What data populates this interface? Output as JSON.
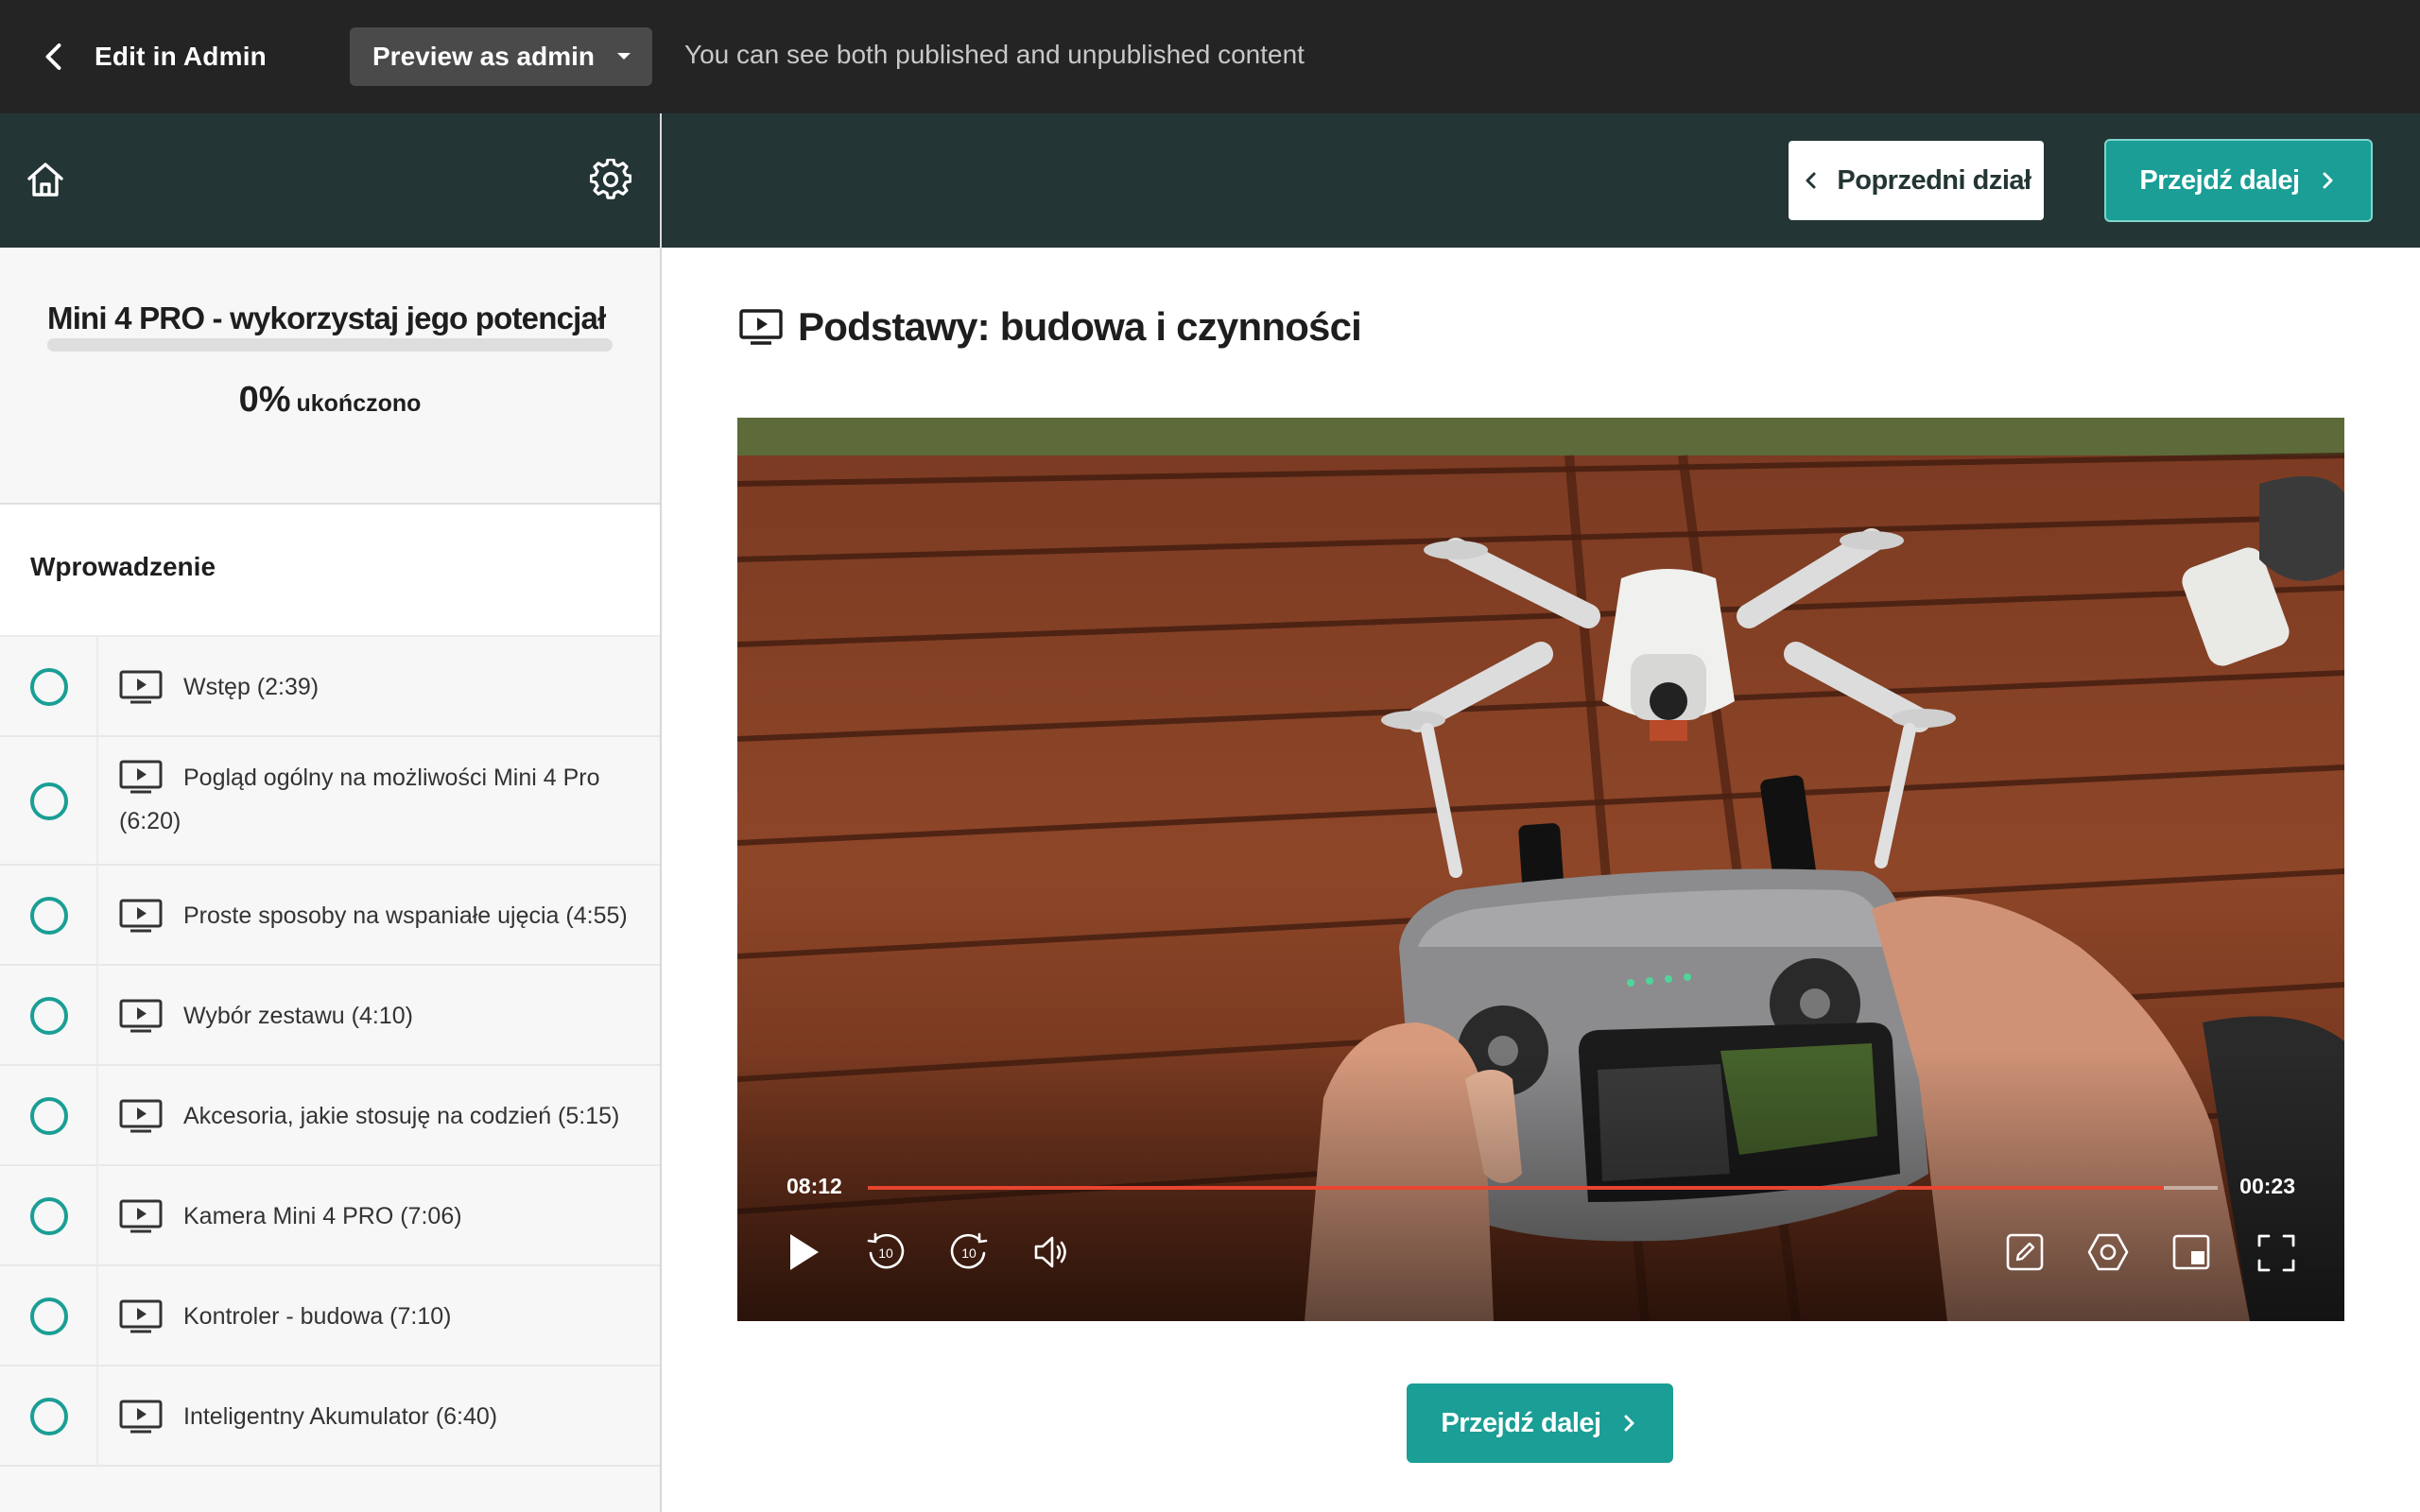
{
  "admin_bar": {
    "back_label": "Edit in Admin",
    "preview_label": "Preview as admin",
    "note": "You can see both published and unpublished content"
  },
  "sidebar": {
    "course_title": "Mini 4 PRO - wykorzystaj jego potencjał",
    "progress": {
      "percent_text": "0%",
      "percent": 0,
      "label": "ukończono"
    },
    "section_title": "Wprowadzenie",
    "lessons": [
      {
        "title": "Wstęp (2:39)"
      },
      {
        "title": "Pogląd ogólny na możliwości Mini 4 Pro (6:20)"
      },
      {
        "title": "Proste sposoby na wspaniałe ujęcia (4:55)"
      },
      {
        "title": "Wybór zestawu (4:10)"
      },
      {
        "title": "Akcesoria, jakie stosuję na codzień (5:15)"
      },
      {
        "title": "Kamera Mini 4 PRO (7:06)"
      },
      {
        "title": "Kontroler - budowa (7:10)"
      },
      {
        "title": "Inteligentny Akumulator (6:40)"
      }
    ]
  },
  "header": {
    "prev_label": "Poprzedni dział",
    "next_label": "Przejdź dalej"
  },
  "main": {
    "lesson_title": "Podstawy: budowa i czynności",
    "next_label": "Przejdź dalej"
  },
  "player": {
    "current_time": "08:12",
    "remaining_time": "00:23",
    "played_fraction": 0.96,
    "skip_seconds_label": "10",
    "controls": [
      "play-icon",
      "rewind-10-icon",
      "forward-10-icon",
      "volume-icon",
      "annotate-icon",
      "settings-icon",
      "pip-icon",
      "fullscreen-icon"
    ]
  },
  "colors": {
    "teal": "#1a9e95",
    "dark_header": "#233534",
    "admin_bar": "#242424",
    "seek_played": "#e8442f"
  }
}
